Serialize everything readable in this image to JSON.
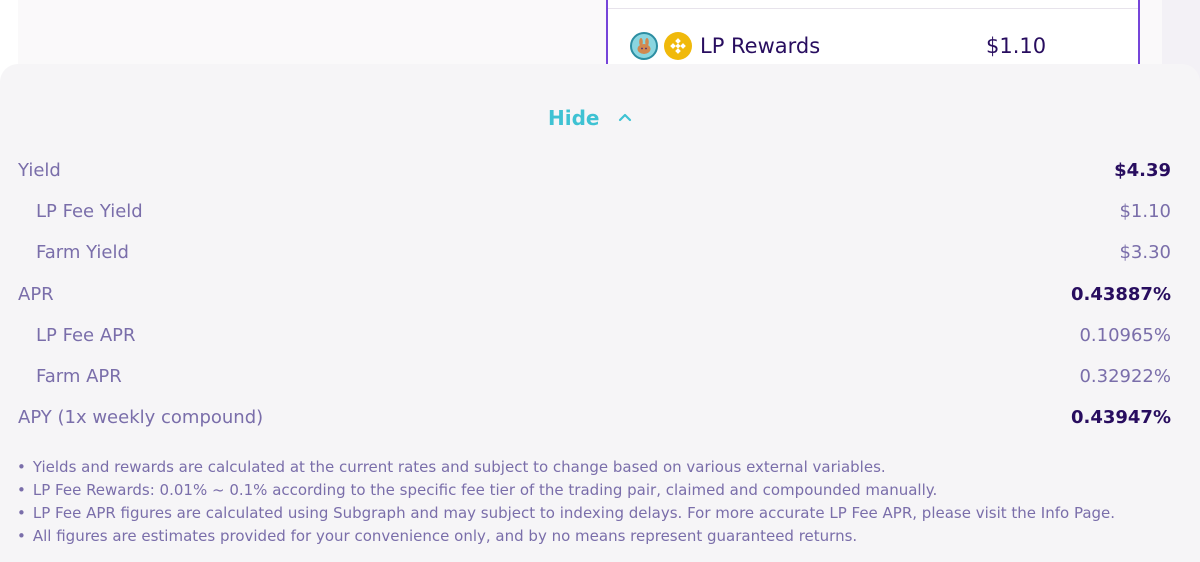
{
  "roi_card": {
    "lp_rewards_label": "LP Rewards",
    "lp_rewards_value": "$1.10",
    "icons": [
      "cake-token-icon",
      "bnb-token-icon"
    ]
  },
  "details": {
    "hide_label": "Hide",
    "rows": [
      {
        "label": "Yield",
        "value": "$4.39"
      },
      {
        "label": "LP Fee Yield",
        "value": "$1.10"
      },
      {
        "label": "Farm Yield",
        "value": "$3.30"
      },
      {
        "label": "APR",
        "value": "0.43887%"
      },
      {
        "label": "LP Fee APR",
        "value": "0.10965%"
      },
      {
        "label": "Farm APR",
        "value": "0.32922%"
      },
      {
        "label": "APY (1x weekly compound)",
        "value": "0.43947%"
      }
    ],
    "notes": [
      "Yields and rewards are calculated at the current rates and subject to change based on various external variables.",
      "LP Fee Rewards: 0.01% ~ 0.1% according to the specific fee tier of the trading pair, claimed and compounded manually.",
      "LP Fee APR figures are calculated using Subgraph and may subject to indexing delays. For more accurate LP Fee APR, please visit the Info Page.",
      "All figures are estimates provided for your convenience only, and by no means represent guaranteed returns."
    ]
  },
  "colors": {
    "primary": "#7645d9",
    "accent": "#3fc2d3",
    "text_strong": "#280d5f",
    "text_secondary": "#7a6eaa"
  }
}
